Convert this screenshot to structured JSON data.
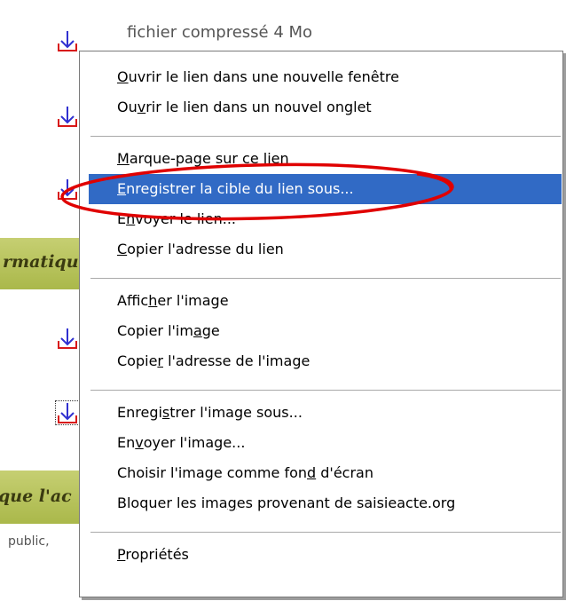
{
  "background": {
    "link_text": "fichier compressé 4 Mo",
    "band_1_text": "rmatiqu",
    "band_2_text": "que l'ac",
    "footer_text": "public,",
    "download_icon": "download-arrow-icon"
  },
  "context_menu": {
    "items": [
      {
        "before": "",
        "key": "O",
        "after": "uvrir le lien dans une nouvelle fenêtre"
      },
      {
        "before": "Ou",
        "key": "v",
        "after": "rir le lien dans un nouvel onglet"
      },
      {
        "before": "",
        "key": "M",
        "after": "arque-page sur ce lien"
      },
      {
        "before": "",
        "key": "E",
        "after": "nregistrer la cible du lien sous..."
      },
      {
        "before": "E",
        "key": "n",
        "after": "voyer le lien..."
      },
      {
        "before": "",
        "key": "C",
        "after": "opier l'adresse du lien"
      },
      {
        "before": "Affic",
        "key": "h",
        "after": "er l'image"
      },
      {
        "before": "Copier l'im",
        "key": "a",
        "after": "ge"
      },
      {
        "before": "Copie",
        "key": "r",
        "after": " l'adresse de l'image"
      },
      {
        "before": "Enregi",
        "key": "s",
        "after": "trer l'image sous..."
      },
      {
        "before": "En",
        "key": "v",
        "after": "oyer l'image..."
      },
      {
        "before": "Choisir l'image comme fon",
        "key": "d",
        "after": " d'écran"
      },
      {
        "before": "Bloquer les ima",
        "key": "g",
        "after": "es provenant de saisieacte.org"
      },
      {
        "before": "",
        "key": "P",
        "after": "ropriétés"
      }
    ],
    "highlighted_item": "Enregistrer la cible du lien sous..."
  },
  "colors": {
    "highlight": "#316ac5",
    "annotation_ellipse": "#e00000",
    "band": "#b4c05a",
    "icon_arrow": "#3030d0",
    "icon_tray": "#d81818"
  }
}
